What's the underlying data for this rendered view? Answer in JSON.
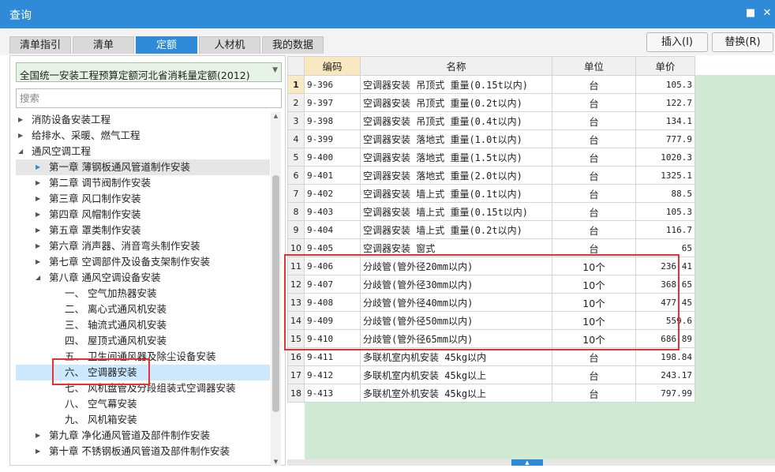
{
  "window": {
    "title": "查询"
  },
  "tabs": [
    {
      "label": "清单指引",
      "active": false
    },
    {
      "label": "清单",
      "active": false
    },
    {
      "label": "定额",
      "active": true
    },
    {
      "label": "人材机",
      "active": false
    },
    {
      "label": "我的数据",
      "active": false
    }
  ],
  "actions": {
    "insert": "插入(I)",
    "replace": "替换(R)"
  },
  "library": {
    "selected": "全国统一安装工程预算定额河北省消耗量定额(2012)"
  },
  "search": {
    "placeholder": "搜索"
  },
  "tree": [
    {
      "label": "消防设备安装工程",
      "toggle": "collapsed"
    },
    {
      "label": "给排水、采暖、燃气工程",
      "toggle": "collapsed"
    },
    {
      "label": "通风空调工程",
      "toggle": "expanded"
    },
    {
      "label": "第一章 薄钢板通风管道制作安装",
      "toggle": "collapsed",
      "highlight": true
    },
    {
      "label": "第二章 调节阀制作安装",
      "toggle": "collapsed"
    },
    {
      "label": "第三章 风口制作安装",
      "toggle": "collapsed"
    },
    {
      "label": "第四章 风帽制作安装",
      "toggle": "collapsed"
    },
    {
      "label": "第五章 罩类制作安装",
      "toggle": "collapsed"
    },
    {
      "label": "第六章 消声器、消音弯头制作安装",
      "toggle": "collapsed"
    },
    {
      "label": "第七章 空调部件及设备支架制作安装",
      "toggle": "collapsed"
    },
    {
      "label": "第八章 通风空调设备安装",
      "toggle": "expanded"
    },
    {
      "label": "一、 空气加热器安装",
      "toggle": "none"
    },
    {
      "label": "二、 离心式通风机安装",
      "toggle": "none"
    },
    {
      "label": "三、 轴流式通风机安装",
      "toggle": "none"
    },
    {
      "label": "四、 屋顶式通风机安装",
      "toggle": "none"
    },
    {
      "label": "五、 卫生间通风器及除尘设备安装",
      "toggle": "none"
    },
    {
      "label": "六、 空调器安装",
      "toggle": "none",
      "selected": true
    },
    {
      "label": "七、 风机盘管及分段组装式空调器安装",
      "toggle": "none"
    },
    {
      "label": "八、 空气幕安装",
      "toggle": "none"
    },
    {
      "label": "九、 风机箱安装",
      "toggle": "none"
    },
    {
      "label": "第九章 净化通风管道及部件制作安装",
      "toggle": "collapsed"
    },
    {
      "label": "第十章 不锈钢板通风管道及部件制作安装",
      "toggle": "collapsed"
    }
  ],
  "table": {
    "headers": {
      "code": "编码",
      "name": "名称",
      "unit": "单位",
      "price": "单价"
    },
    "rows": [
      {
        "idx": "1",
        "code": "9-396",
        "name": "空调器安装 吊顶式 重量(0.15t以内)",
        "unit": "台",
        "price": "105.3"
      },
      {
        "idx": "2",
        "code": "9-397",
        "name": "空调器安装 吊顶式 重量(0.2t以内)",
        "unit": "台",
        "price": "122.7"
      },
      {
        "idx": "3",
        "code": "9-398",
        "name": "空调器安装 吊顶式 重量(0.4t以内)",
        "unit": "台",
        "price": "134.1"
      },
      {
        "idx": "4",
        "code": "9-399",
        "name": "空调器安装 落地式 重量(1.0t以内)",
        "unit": "台",
        "price": "777.9"
      },
      {
        "idx": "5",
        "code": "9-400",
        "name": "空调器安装 落地式 重量(1.5t以内)",
        "unit": "台",
        "price": "1020.3"
      },
      {
        "idx": "6",
        "code": "9-401",
        "name": "空调器安装 落地式 重量(2.0t以内)",
        "unit": "台",
        "price": "1325.1"
      },
      {
        "idx": "7",
        "code": "9-402",
        "name": "空调器安装 墙上式 重量(0.1t以内)",
        "unit": "台",
        "price": "88.5"
      },
      {
        "idx": "8",
        "code": "9-403",
        "name": "空调器安装 墙上式 重量(0.15t以内)",
        "unit": "台",
        "price": "105.3"
      },
      {
        "idx": "9",
        "code": "9-404",
        "name": "空调器安装 墙上式 重量(0.2t以内)",
        "unit": "台",
        "price": "116.7"
      },
      {
        "idx": "10",
        "code": "9-405",
        "name": "空调器安装 窗式",
        "unit": "台",
        "price": "65"
      },
      {
        "idx": "11",
        "code": "9-406",
        "name": "分歧管(管外径20mm以内)",
        "unit": "10个",
        "price": "236.41"
      },
      {
        "idx": "12",
        "code": "9-407",
        "name": "分歧管(管外径30mm以内)",
        "unit": "10个",
        "price": "368.65"
      },
      {
        "idx": "13",
        "code": "9-408",
        "name": "分歧管(管外径40mm以内)",
        "unit": "10个",
        "price": "477.45"
      },
      {
        "idx": "14",
        "code": "9-409",
        "name": "分歧管(管外径50mm以内)",
        "unit": "10个",
        "price": "559.6"
      },
      {
        "idx": "15",
        "code": "9-410",
        "name": "分歧管(管外径65mm以内)",
        "unit": "10个",
        "price": "686.89"
      },
      {
        "idx": "16",
        "code": "9-411",
        "name": "多联机室内机安装 45kg以内",
        "unit": "台",
        "price": "198.84"
      },
      {
        "idx": "17",
        "code": "9-412",
        "name": "多联机室内机安装 45kg以上",
        "unit": "台",
        "price": "243.17"
      },
      {
        "idx": "18",
        "code": "9-413",
        "name": "多联机室外机安装 45kg以上",
        "unit": "台",
        "price": "797.99"
      }
    ]
  },
  "colors": {
    "accent": "#2f8ad8",
    "highlight_box": "#e53333",
    "grid_fill": "#cfe9d3",
    "selection": "#cce8ff"
  }
}
